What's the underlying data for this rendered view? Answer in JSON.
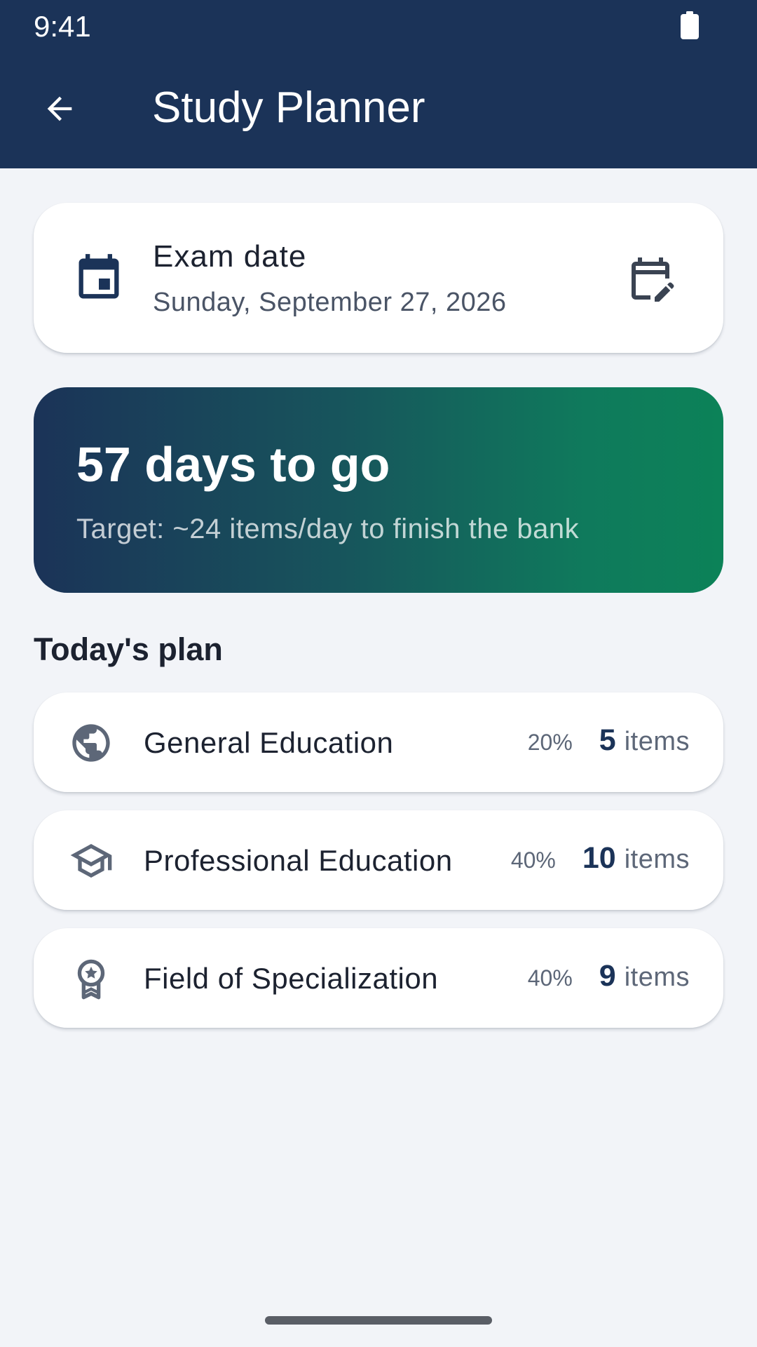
{
  "status_bar": {
    "time": "9:41"
  },
  "app_bar": {
    "title": "Study Planner"
  },
  "exam": {
    "label": "Exam date",
    "value": "Sunday, September 27, 2026"
  },
  "countdown": {
    "title": "57 days to go",
    "subtitle": "Target: ~24 items/day to finish the bank"
  },
  "plan": {
    "section_title": "Today's plan",
    "items": [
      {
        "icon": "globe-icon",
        "name": "General Education",
        "percent": "20%",
        "count": "5",
        "unit": "items"
      },
      {
        "icon": "graduation-cap-icon",
        "name": "Professional Education",
        "percent": "40%",
        "count": "10",
        "unit": "items"
      },
      {
        "icon": "award-ribbon-icon",
        "name": "Field of Specialization",
        "percent": "40%",
        "count": "9",
        "unit": "items"
      }
    ]
  },
  "colors": {
    "primary": "#1b3358",
    "accent_green": "#0c8258",
    "background": "#f2f4f8",
    "icon_grey": "#5d6778"
  }
}
